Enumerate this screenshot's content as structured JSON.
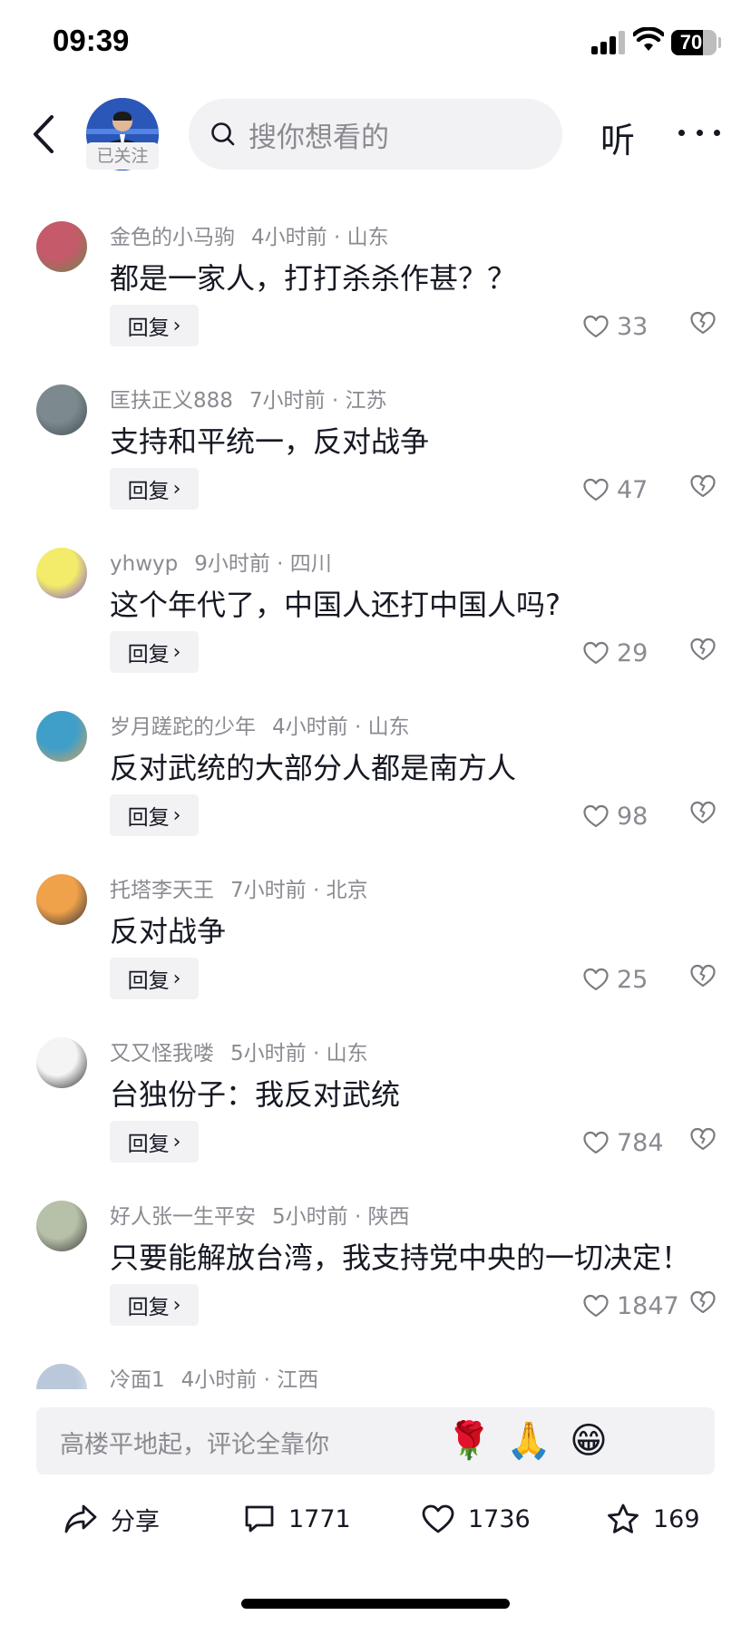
{
  "status_bar": {
    "time": "09:39",
    "battery": "70",
    "battery_level_pct": 70
  },
  "header": {
    "follow_badge": "已关注",
    "search_placeholder": "搜你想看的",
    "listen_label": "听"
  },
  "comments": [
    {
      "user": "金色的小马驹",
      "time": "4小时前",
      "location": "山东",
      "text": "都是一家人，打打杀杀作甚？？",
      "reply": "回复",
      "likes": "33",
      "avatar_colors": [
        "#c45a6a",
        "#6a8a4a"
      ]
    },
    {
      "user": "匡扶正义888",
      "time": "7小时前",
      "location": "江苏",
      "text": "支持和平统一，反对战争",
      "reply": "回复",
      "likes": "47",
      "avatar_colors": [
        "#7c8a90",
        "#3e4a4f"
      ]
    },
    {
      "user": "yhwyp",
      "time": "9小时前",
      "location": "四川",
      "text": "这个年代了，中国人还打中国人吗?",
      "reply": "回复",
      "likes": "29",
      "avatar_colors": [
        "#f2ec6a",
        "#7a4fd6"
      ]
    },
    {
      "user": "岁月蹉跎的少年",
      "time": "4小时前",
      "location": "山东",
      "text": "反对武统的大部分人都是南方人",
      "reply": "回复",
      "likes": "98",
      "avatar_colors": [
        "#3f9fc9",
        "#d9a05a"
      ]
    },
    {
      "user": "托塔李天王",
      "time": "7小时前",
      "location": "北京",
      "text": "反对战争",
      "reply": "回复",
      "likes": "25",
      "avatar_colors": [
        "#f0a24a",
        "#2c2c3a"
      ]
    },
    {
      "user": "又又怪我喽",
      "time": "5小时前",
      "location": "山东",
      "text": "台独份子：我反对武统",
      "reply": "回复",
      "likes": "784",
      "avatar_colors": [
        "#f4f4f4",
        "#222222"
      ]
    },
    {
      "user": "好人张一生平安",
      "time": "5小时前",
      "location": "陕西",
      "text": "只要能解放台湾，我支持党中央的一切决定！",
      "reply": "回复",
      "likes": "1847",
      "avatar_colors": [
        "#b7c0a8",
        "#3a3a3a"
      ]
    },
    {
      "user": "冷面1",
      "time": "4小时前",
      "location": "江西",
      "text": "",
      "reply": "",
      "likes": "",
      "avatar_colors": [
        "#b9c8da",
        "#e8eef5"
      ]
    }
  ],
  "input": {
    "placeholder": "高楼平地起，评论全靠你",
    "emojis": [
      "🌹",
      "🙏",
      "😁"
    ]
  },
  "actions": {
    "share": "分享",
    "comments": "1771",
    "likes": "1736",
    "favorites": "169"
  }
}
